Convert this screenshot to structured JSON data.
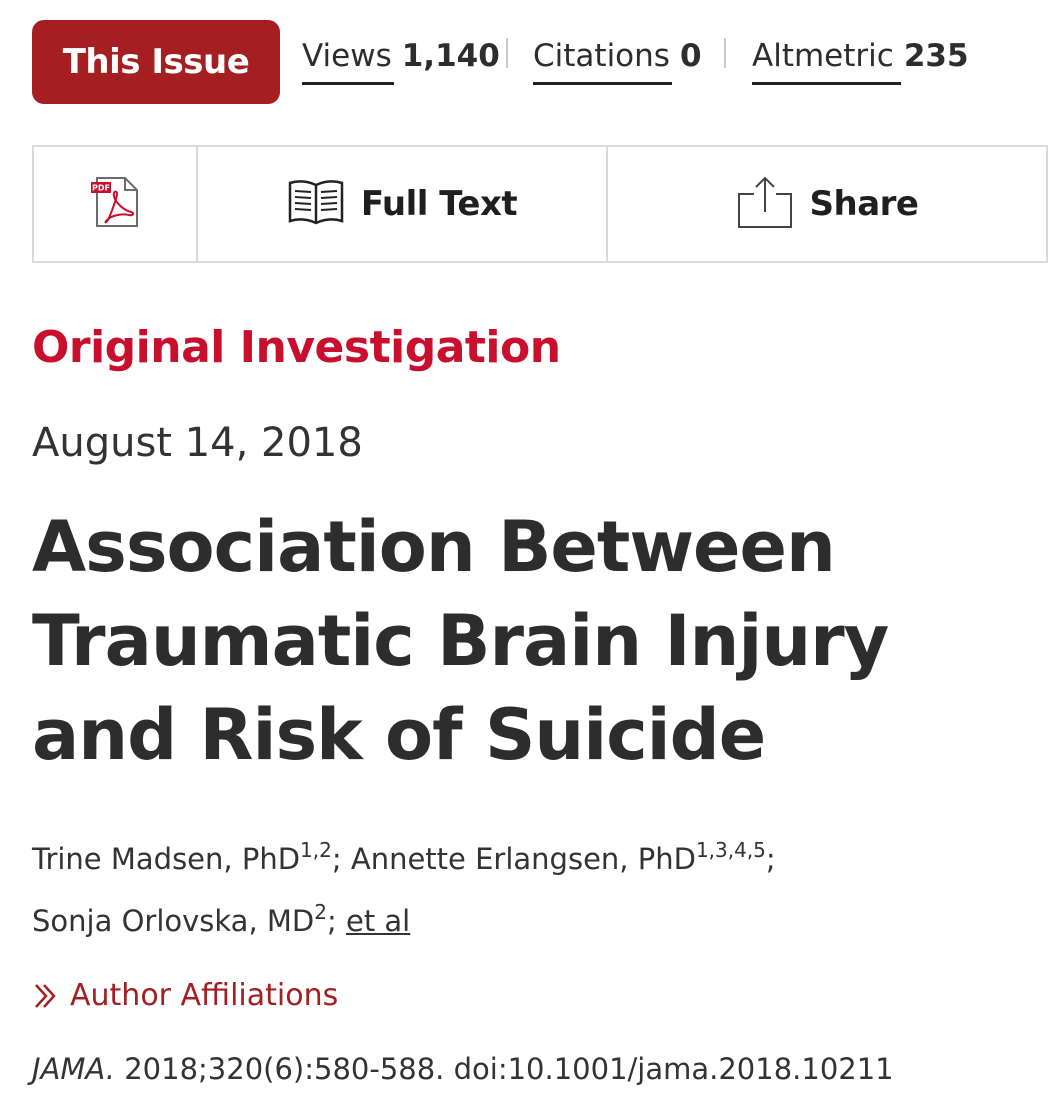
{
  "header": {
    "issue_button": "This Issue",
    "metrics": [
      {
        "label": "Views",
        "value": "1,140"
      },
      {
        "label": "Citations",
        "value": "0"
      },
      {
        "label": "Altmetric",
        "value": "235"
      }
    ]
  },
  "toolbar": {
    "pdf_tag": "PDF",
    "full_text_label": "Full Text",
    "share_label": "Share"
  },
  "article": {
    "type": "Original Investigation",
    "date": "August 14, 2018",
    "title": "Association Between Traumatic Brain Injury and Risk of Suicide",
    "authors": [
      {
        "name": "Trine Madsen, PhD",
        "affiliations": "1,2",
        "sep": "; "
      },
      {
        "name": "Annette Erlangsen, PhD",
        "affiliations": "1,3,4,5",
        "sep": ";"
      },
      {
        "name": "Sonja Orlovska, MD",
        "affiliations": "2",
        "sep": "; "
      }
    ],
    "et_al": "et al",
    "affiliations_link": "Author Affiliations",
    "citation": {
      "journal": "JAMA.",
      "details": " 2018;320(6):580-588. doi:10.1001/jama.2018.10211"
    }
  },
  "colors": {
    "brand_red": "#a51e22",
    "accent_red": "#c8102e",
    "text": "#2d2d2d"
  },
  "icons": [
    "pdf-icon",
    "book-icon",
    "share-icon",
    "chevron-right-icon"
  ]
}
